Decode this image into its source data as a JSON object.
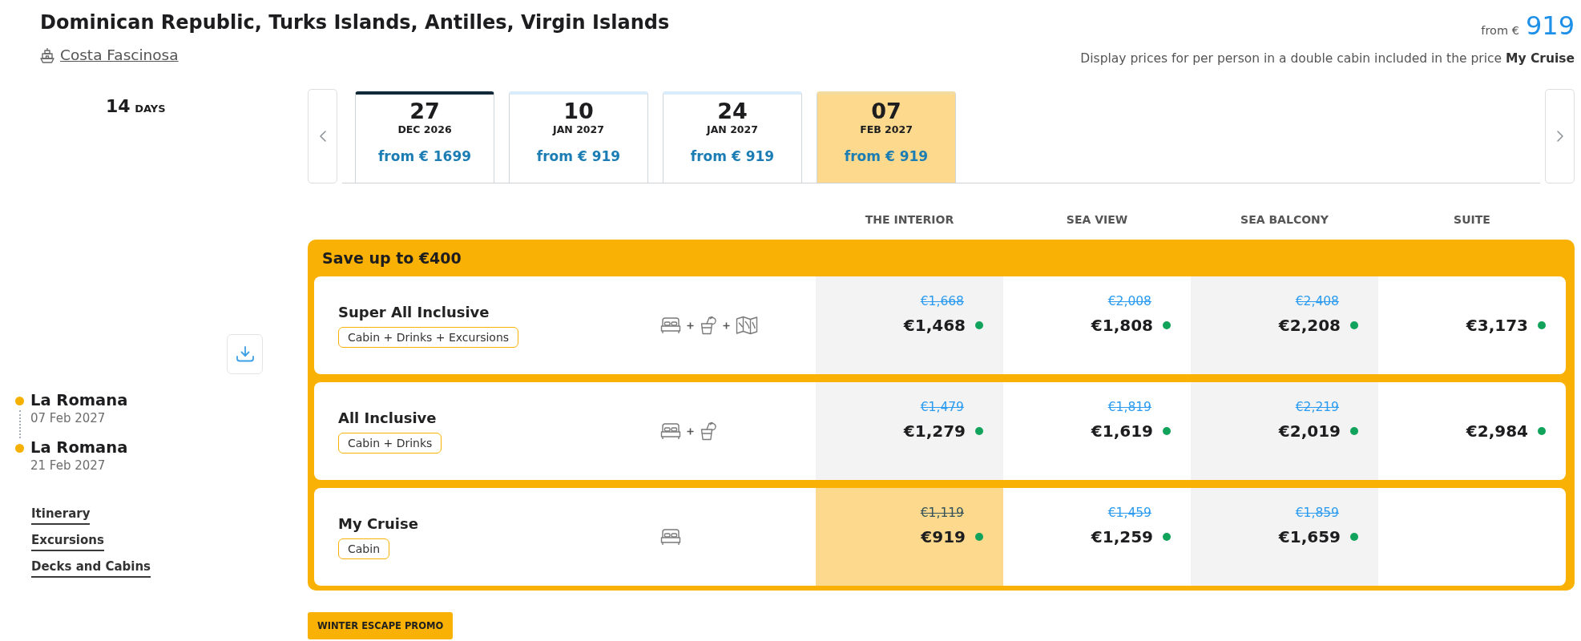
{
  "header": {
    "title": "Dominican Republic, Turks Islands, Antilles, Virgin Islands",
    "ship": "Costa Fascinosa",
    "price_prefix": "from €",
    "price": "919",
    "note": "Display prices for per person in a double cabin included in the price **My Cruise**"
  },
  "duration": {
    "value": "14",
    "unit": "DAYS"
  },
  "sidebar": {
    "route": [
      {
        "port": "La Romana",
        "date": "07 Feb 2027"
      },
      {
        "port": "La Romana",
        "date": "21 Feb 2027"
      }
    ],
    "links": [
      "Itinerary",
      "Excursions",
      "Decks and Cabins"
    ]
  },
  "dates": [
    {
      "day": "27",
      "month": "DEC 2026",
      "price": "from € 1699",
      "selected": false,
      "focused": true
    },
    {
      "day": "10",
      "month": "JAN 2027",
      "price": "from € 919",
      "selected": false,
      "focused": false
    },
    {
      "day": "24",
      "month": "JAN 2027",
      "price": "from € 919",
      "selected": false,
      "focused": false
    },
    {
      "day": "07",
      "month": "FEB 2027",
      "price": "from € 919",
      "selected": true,
      "focused": false
    }
  ],
  "cabin_columns": [
    "THE INTERIOR",
    "SEA VIEW",
    "SEA BALCONY",
    "SUITE"
  ],
  "promo": {
    "banner": "Save up to €400",
    "fares": [
      {
        "name": "Super All Inclusive",
        "tag": "Cabin + Drinks + Excursions",
        "includes": [
          {
            "kind": "cabin"
          },
          {
            "kind": "drinks"
          },
          {
            "kind": "excursions"
          }
        ],
        "prices": [
          {
            "old": "€1,668",
            "price": "€1,468",
            "selected": false,
            "available": true
          },
          {
            "old": "€2,008",
            "price": "€1,808",
            "selected": false,
            "available": true
          },
          {
            "old": "€2,408",
            "price": "€2,208",
            "selected": false,
            "available": true
          },
          {
            "price": "€3,173",
            "selected": false,
            "available": true
          }
        ]
      },
      {
        "name": "All Inclusive",
        "tag": "Cabin + Drinks",
        "includes": [
          {
            "kind": "cabin"
          },
          {
            "kind": "drinks"
          }
        ],
        "prices": [
          {
            "old": "€1,479",
            "price": "€1,279",
            "selected": false,
            "available": true
          },
          {
            "old": "€1,819",
            "price": "€1,619",
            "selected": false,
            "available": true
          },
          {
            "old": "€2,219",
            "price": "€2,019",
            "selected": false,
            "available": true
          },
          {
            "price": "€2,984",
            "selected": false,
            "available": true
          }
        ]
      },
      {
        "name": "My Cruise",
        "tag": "Cabin",
        "includes": [
          {
            "kind": "cabin"
          }
        ],
        "prices": [
          {
            "old": "€1,119",
            "price": "€919",
            "selected": true,
            "available": true
          },
          {
            "old": "€1,459",
            "price": "€1,259",
            "selected": false,
            "available": true
          },
          {
            "old": "€1,859",
            "price": "€1,659",
            "selected": false,
            "available": true
          }
        ]
      }
    ]
  },
  "promo_button": "WINTER ESCAPE PROMO"
}
